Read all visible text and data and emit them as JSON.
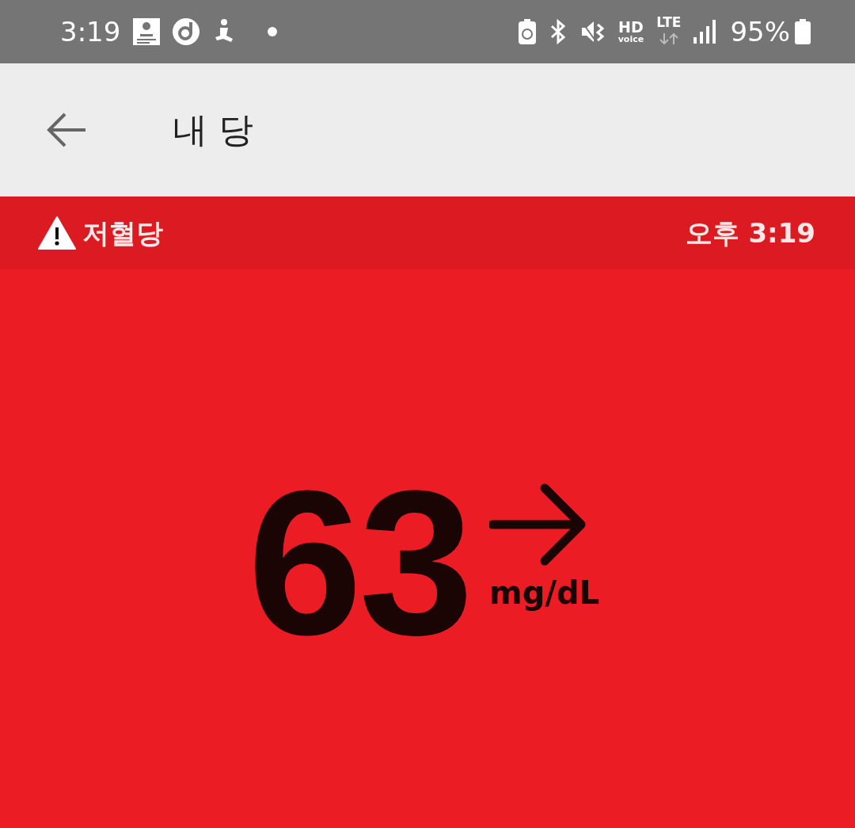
{
  "status_bar": {
    "time": "3:19",
    "hd_label": "HD",
    "hd_sub": "voice",
    "network": "LTE",
    "battery": "95%"
  },
  "app_bar": {
    "title": "내 당"
  },
  "alert": {
    "label": "저혈당",
    "time": "오후 3:19"
  },
  "reading": {
    "value": "63",
    "unit": "mg/dL",
    "trend_arrow": {
      "kind": "flat"
    }
  }
}
